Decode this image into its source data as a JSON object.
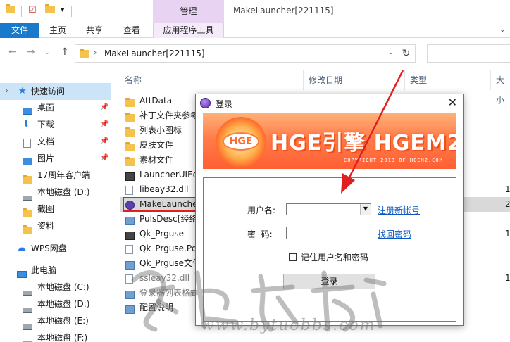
{
  "window": {
    "title": "MakeLauncher[221115]",
    "manage_tab": "管理"
  },
  "ribbon": {
    "tabs": [
      "文件",
      "主页",
      "共享",
      "查看",
      "应用程序工具"
    ]
  },
  "address": {
    "path": "MakeLauncher[221115]"
  },
  "nav": {
    "quick_access": "快速访问",
    "items": [
      {
        "label": "桌面",
        "pinned": true
      },
      {
        "label": "下载",
        "pinned": true
      },
      {
        "label": "文档",
        "pinned": true
      },
      {
        "label": "图片",
        "pinned": true
      },
      {
        "label": "17周年客户端",
        "pinned": false
      },
      {
        "label": "本地磁盘 (D:)",
        "pinned": false
      },
      {
        "label": "截图",
        "pinned": false
      },
      {
        "label": "资料",
        "pinned": false
      }
    ],
    "wps": "WPS网盘",
    "this_pc": "此电脑",
    "drives": [
      "本地磁盘 (C:)",
      "本地磁盘 (D:)",
      "本地磁盘 (E:)",
      "本地磁盘 (F:)"
    ]
  },
  "columns": {
    "name": "名称",
    "date": "修改日期",
    "type": "类型",
    "size": "大小"
  },
  "files": [
    {
      "name": "AttData",
      "icon": "folder-icon",
      "size": ""
    },
    {
      "name": "补丁文件夹参考",
      "icon": "folder-icon",
      "size": ""
    },
    {
      "name": "列表小图标",
      "icon": "folder-icon",
      "size": ""
    },
    {
      "name": "皮肤文件",
      "icon": "folder-icon",
      "size": ""
    },
    {
      "name": "素材文件",
      "icon": "folder-icon",
      "size": ""
    },
    {
      "name": "LauncherUIEdi",
      "icon": "app-icon",
      "size": ""
    },
    {
      "name": "libeay32.dll",
      "icon": "dll-icon",
      "size": "1"
    },
    {
      "name": "MakeLauncher",
      "icon": "exe-icon",
      "size": "2"
    },
    {
      "name": "PulsDesc[经络",
      "icon": "img-icon",
      "size": ""
    },
    {
      "name": "Qk_Prguse",
      "icon": "app-icon",
      "size": "1"
    },
    {
      "name": "Qk_Prguse.Pdz",
      "icon": "txt-icon",
      "size": ""
    },
    {
      "name": "Qk_Prguse文件",
      "icon": "img-icon",
      "size": ""
    },
    {
      "name": "ssleay32.dll",
      "icon": "dll-icon",
      "size": "1"
    },
    {
      "name": "登录器列表格式",
      "icon": "img-icon",
      "size": ""
    },
    {
      "name": "配置说明",
      "icon": "img-icon",
      "size": ""
    }
  ],
  "dialog": {
    "title": "登录",
    "banner_logo": "HGE",
    "banner_text": "HGE引擎 HGEM2",
    "banner_copyright": "COPYRIGHT 2013 OF HGEM2.COM",
    "username_label": "用户名:",
    "username_value": "",
    "register_link": "注册新帐号",
    "password_label": "密  码:",
    "password_value": "",
    "recover_link": "找回密码",
    "remember_label": "记住用户名和密码",
    "remember_checked": false,
    "login_button": "登录"
  },
  "watermark": {
    "url": "www.bytuobbs.com"
  },
  "colors": {
    "file_tab": "#1979ca",
    "manage_tab": "#e9d3f2",
    "selection": "#cce4f7",
    "highlight_box": "#e02020",
    "arrow": "#e02020",
    "link": "#0b57c4"
  }
}
